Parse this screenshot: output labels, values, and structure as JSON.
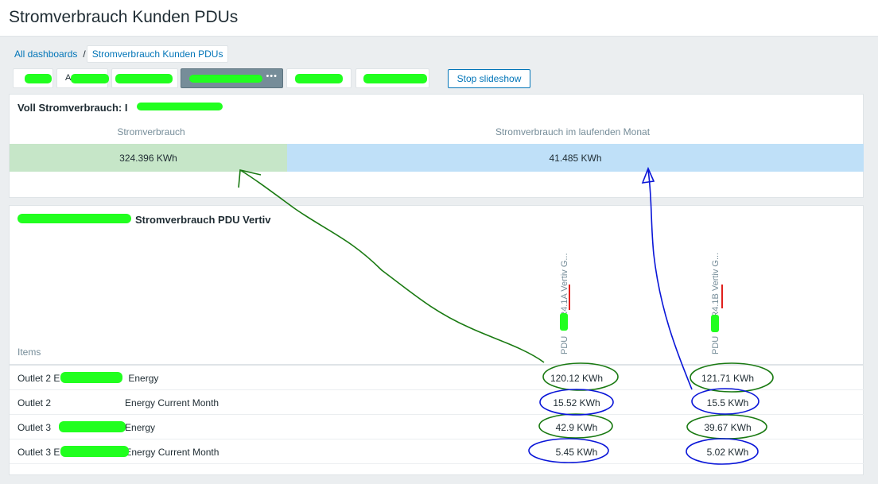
{
  "header": {
    "title": "Stromverbrauch Kunden PDUs"
  },
  "breadcrumb": {
    "root": "All dashboards",
    "separator": "/",
    "current": "Stromverbrauch Kunden PDUs"
  },
  "tabs": {
    "more": "•••",
    "fragment": "A"
  },
  "toolbar": {
    "stop_slideshow": "Stop slideshow"
  },
  "widget1": {
    "title": "Voll Stromverbrauch: I",
    "columns": [
      "Stromverbrauch",
      "Stromverbrauch im laufenden Monat"
    ],
    "values": [
      "324.396 KWh",
      "41.485 KWh"
    ]
  },
  "widget2": {
    "title": "Stromverbrauch PDU Vertiv",
    "items_label": "Items",
    "column_a": {
      "prefix": "PDU",
      "suffix": "R4.1A Vertiv G..."
    },
    "column_b": {
      "prefix": "PDU",
      "suffix": "R4.1B Vertiv G..."
    },
    "rows": [
      {
        "pre": "Outlet 2 E",
        "post": "Energy",
        "a": "120.12 KWh",
        "b": "121.71 KWh"
      },
      {
        "pre": "Outlet 2",
        "post": "Energy Current Month",
        "a": "15.52 KWh",
        "b": "15.5 KWh"
      },
      {
        "pre": "Outlet 3",
        "post": "Energy",
        "a": "42.9 KWh",
        "b": "39.67 KWh"
      },
      {
        "pre": "Outlet 3 E",
        "post": "Energy Current Month",
        "a": "5.45 KWh",
        "b": "5.02 KWh"
      }
    ]
  },
  "colors": {
    "green_tile": "#c6e6c8",
    "blue_tile": "#bfe0f8",
    "accent": "#0275b8",
    "redaction": "#21ff1f",
    "annotation_green": "#1a7a12",
    "annotation_blue": "#0a16d8",
    "annotation_red": "#e0201c"
  }
}
